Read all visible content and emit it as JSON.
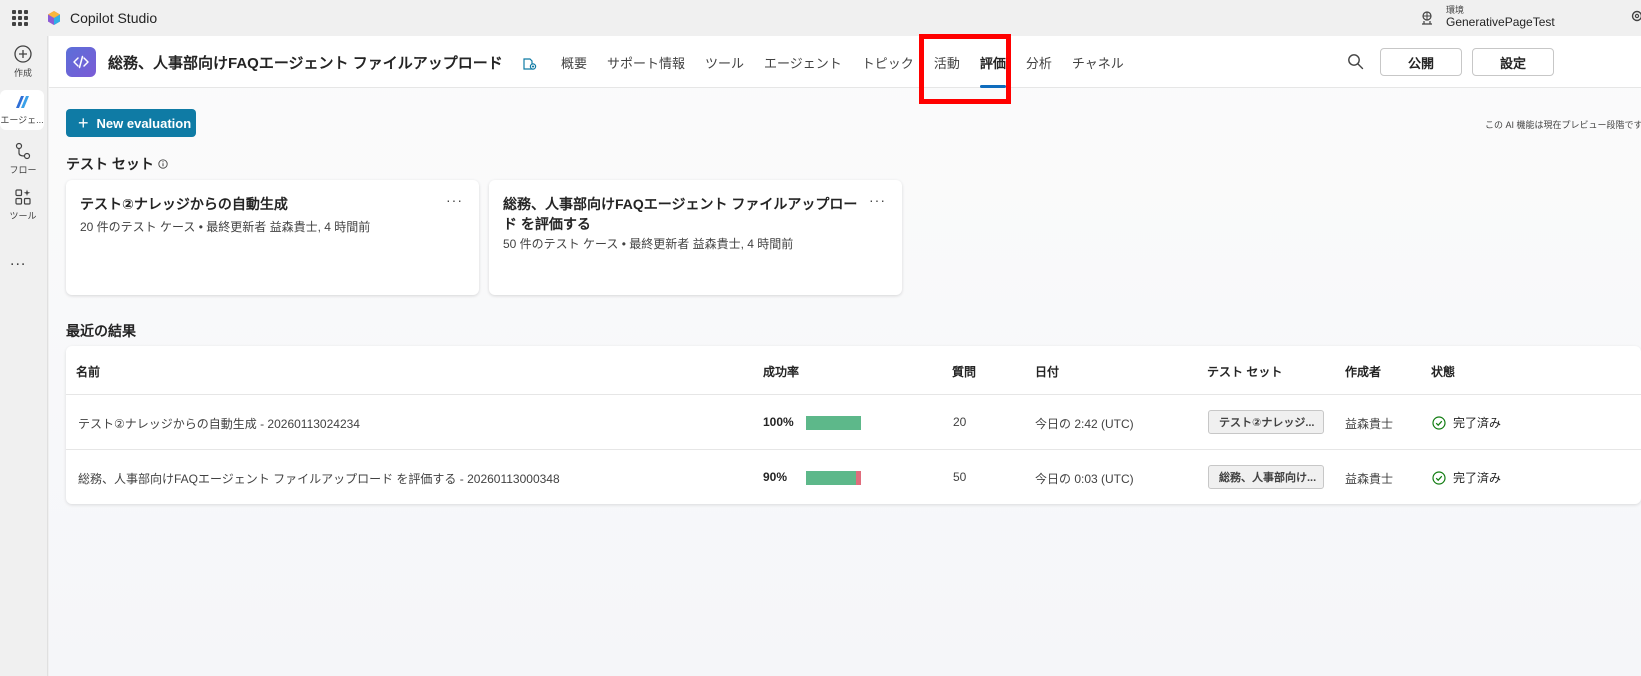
{
  "app": {
    "name": "Copilot Studio",
    "env_label": "環境",
    "env_name": "GenerativePageTest"
  },
  "rail": {
    "create": "作成",
    "agents": "エージェ...",
    "flows": "フロー",
    "tools": "ツール",
    "more": "..."
  },
  "header": {
    "agent_title": "総務、人事部向けFAQエージェント ファイルアップロード",
    "nav": [
      "概要",
      "サポート情報",
      "ツール",
      "エージェント",
      "トピック",
      "活動",
      "評価",
      "分析",
      "チャネル"
    ],
    "active_tab": "評価",
    "publish_label": "公開",
    "settings_label": "設定"
  },
  "toolbar": {
    "new_eval_label": "New evaluation",
    "preview_note": "この AI 機能は現在プレビュー段階です"
  },
  "test_sets": {
    "title": "テスト セット",
    "cards": [
      {
        "title": "テスト②ナレッジからの自動生成",
        "subtitle": "20 件のテスト ケース • 最終更新者 益森貴士, 4 時間前"
      },
      {
        "title": "総務、人事部向けFAQエージェント ファイルアップロード を評価する",
        "subtitle": "50 件のテスト ケース • 最終更新者 益森貴士, 4 時間前"
      }
    ]
  },
  "results": {
    "title": "最近の結果",
    "columns": [
      "名前",
      "成功率",
      "質問",
      "日付",
      "テスト セット",
      "作成者",
      "状態"
    ],
    "rows": [
      {
        "name": "テスト②ナレッジからの自動生成 - 20260113024234",
        "success_rate": "100%",
        "success_fraction": 1.0,
        "questions": "20",
        "date": "今日の 2:42 (UTC)",
        "test_set": "テスト②ナレッジ...",
        "author": "益森貴士",
        "status": "完了済み"
      },
      {
        "name": "総務、人事部向けFAQエージェント ファイルアップロード を評価する - 20260113000348",
        "success_rate": "90%",
        "success_fraction": 0.9,
        "questions": "50",
        "date": "今日の 0:03 (UTC)",
        "test_set": "総務、人事部向け...",
        "author": "益森貴士",
        "status": "完了済み"
      }
    ]
  },
  "colors": {
    "accent": "#0f7ba5",
    "tab_underline": "#0f6cbd",
    "success_bar": "#5db88a",
    "fail_bar": "#e06c7c",
    "highlight": "#ff0000"
  }
}
